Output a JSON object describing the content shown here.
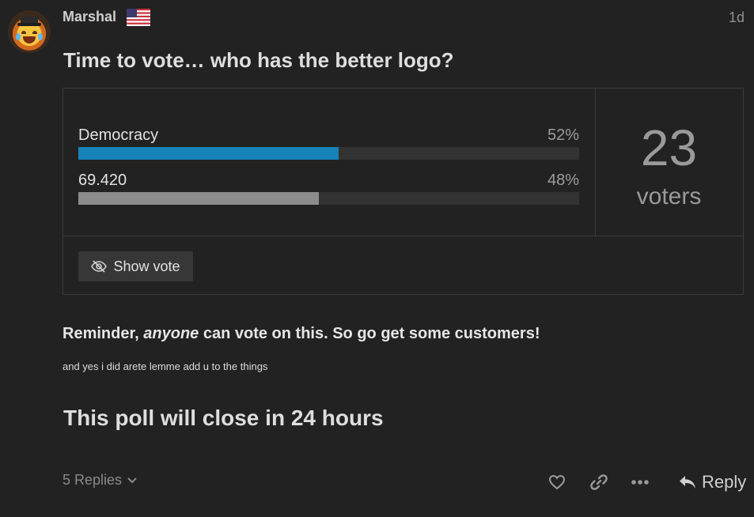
{
  "post": {
    "username": "Marshal",
    "age": "1d",
    "title": "Time to vote… who has the better logo?",
    "reminder_before": "Reminder, ",
    "reminder_emphasis": "anyone",
    "reminder_after": " can vote on this. So go get some customers!",
    "note": "and yes i did arete lemme add u to the things",
    "closing": "This poll will close in 24 hours"
  },
  "poll": {
    "options": [
      {
        "label": "Democracy",
        "percent_text": "52%",
        "percent": 52,
        "color": "#1683b8"
      },
      {
        "label": "69.420",
        "percent_text": "48%",
        "percent": 48,
        "color": "#8c8c8c"
      }
    ],
    "voter_count": "23",
    "voters_label": "voters",
    "show_vote_label": "Show vote",
    "icon": "eye-slash-icon"
  },
  "footer": {
    "replies_label": "5 Replies",
    "reply_label": "Reply",
    "icons": [
      "heart-icon",
      "link-icon",
      "more-icon",
      "reply-icon"
    ]
  },
  "colors": {
    "background": "#222222",
    "bar_track": "#333333",
    "accent": "#1683b8"
  }
}
